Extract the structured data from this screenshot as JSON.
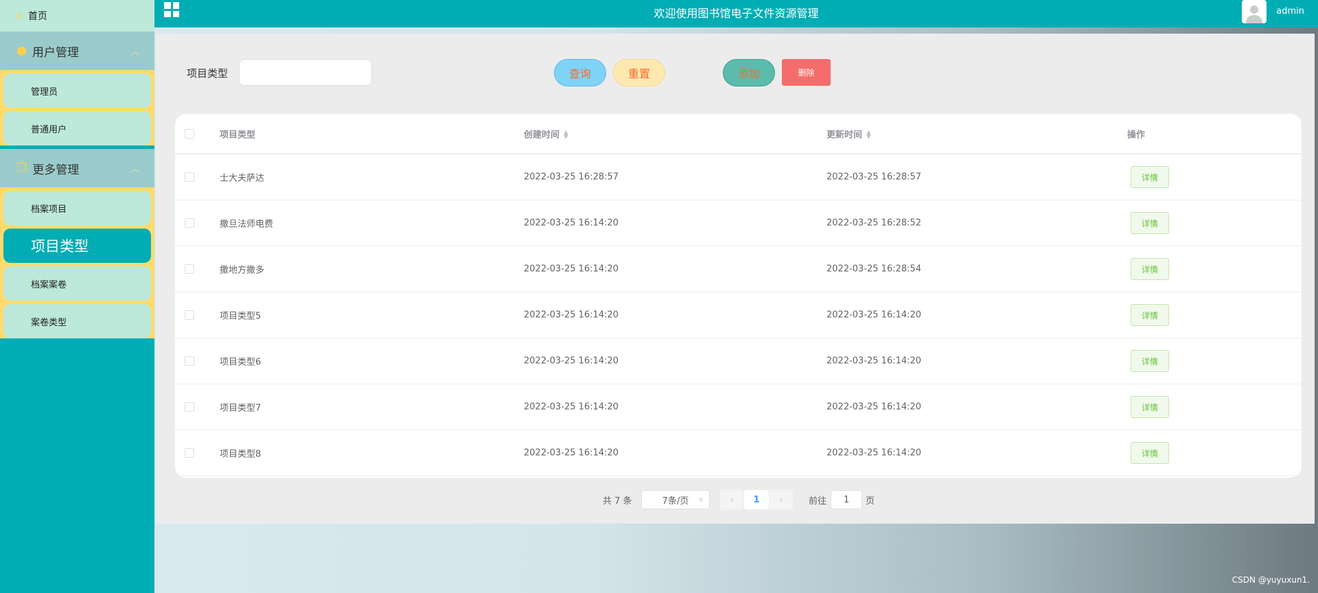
{
  "sidebar": {
    "home": "首页",
    "groups": [
      {
        "label": "用户管理",
        "items": [
          "管理员",
          "普通用户"
        ]
      },
      {
        "label": "更多管理",
        "items": [
          "档案项目",
          "项目类型",
          "档案案卷",
          "案卷类型"
        ]
      }
    ],
    "active": "项目类型"
  },
  "header": {
    "title": "欢迎使用图书馆电子文件资源管理",
    "user": "admin"
  },
  "search": {
    "label": "项目类型",
    "value": "",
    "query": "查询",
    "reset": "重置",
    "add": "添加",
    "delete": "删除"
  },
  "table": {
    "columns": [
      "项目类型",
      "创建时间",
      "更新时间",
      "操作"
    ],
    "action": "详情",
    "rows": [
      [
        "士大夫萨达",
        "2022-03-25 16:28:57",
        "2022-03-25 16:28:57"
      ],
      [
        "撒旦法师电费",
        "2022-03-25 16:14:20",
        "2022-03-25 16:28:52"
      ],
      [
        "撒地方撒多",
        "2022-03-25 16:14:20",
        "2022-03-25 16:28:54"
      ],
      [
        "项目类型5",
        "2022-03-25 16:14:20",
        "2022-03-25 16:14:20"
      ],
      [
        "项目类型6",
        "2022-03-25 16:14:20",
        "2022-03-25 16:14:20"
      ],
      [
        "项目类型7",
        "2022-03-25 16:14:20",
        "2022-03-25 16:14:20"
      ],
      [
        "项目类型8",
        "2022-03-25 16:14:20",
        "2022-03-25 16:14:20"
      ]
    ]
  },
  "pagination": {
    "total": "共 7 条",
    "page_size": "7条/页",
    "current": "1",
    "goto_label": "前往",
    "goto_value": "1",
    "page_suffix": "页"
  },
  "watermark": "CSDN @yuyuxun1."
}
